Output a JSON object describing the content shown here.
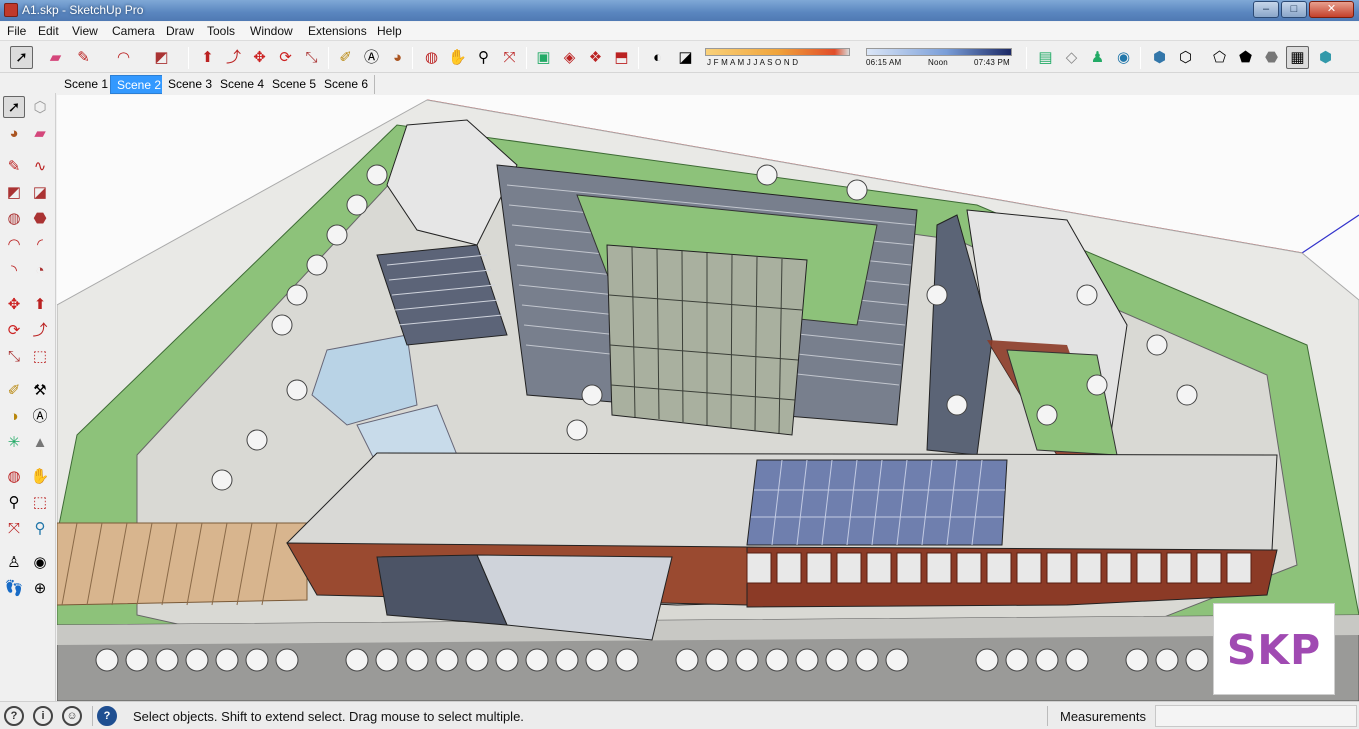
{
  "window": {
    "title": "A1.skp - SketchUp Pro",
    "minimize": "–",
    "maximize": "□",
    "close": "✕"
  },
  "menu": [
    "File",
    "Edit",
    "View",
    "Camera",
    "Draw",
    "Tools",
    "Window",
    "Extensions",
    "Help"
  ],
  "shadow_panel": {
    "months": "J F M A M J J A S O N D",
    "time_start": "06:15 AM",
    "time_mid": "Noon",
    "time_end": "07:43 PM"
  },
  "scenes": [
    "Scene 1",
    "Scene 2",
    "Scene 3",
    "Scene 4",
    "Scene 5",
    "Scene 6"
  ],
  "active_scene": "Scene 2",
  "status": {
    "message": "Select objects. Shift to extend select. Drag mouse to select multiple.",
    "measurements_label": "Measurements",
    "measurements_value": ""
  },
  "watermark": "SKP",
  "colors": {
    "accent": "#3399ff",
    "grass": "#8cc07a",
    "brick": "#8b3a26",
    "roof": "#e4e4e4",
    "glass": "#7a8fb8"
  }
}
